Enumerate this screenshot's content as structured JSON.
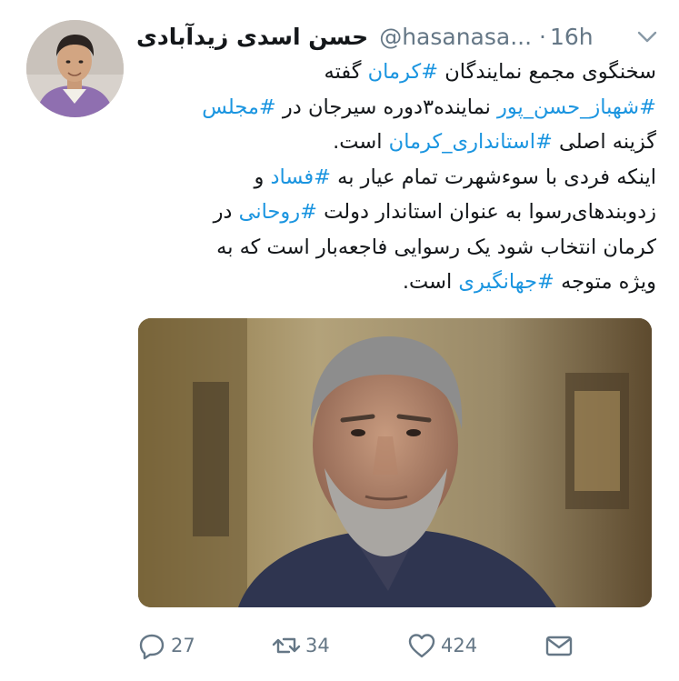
{
  "author": {
    "name": "حسن اسدی زیدآبادی",
    "handle": "@hasanasa...",
    "separator": "·",
    "time": "16h"
  },
  "tweet": {
    "line1": {
      "t1": "سخنگوی مجمع نمایندگان ",
      "h1": "#کرمان",
      "t2": " گفته"
    },
    "line2": {
      "h1": "#شهباز_حسن_پور",
      "t1": " نماینده۳دوره سیرجان در ",
      "h2": "#مجلس"
    },
    "line3": {
      "t1": "گزینه اصلی ",
      "h1": "#استانداری_کرمان",
      "t2": " است."
    },
    "line4": {
      "t1": "اینکه فردی با سوءشهرت تمام عیار به ",
      "h1": "#فساد",
      "t2": " و"
    },
    "line5": {
      "t1": "زدوبندهای‌رسوا به عنوان استاندار دولت ",
      "h1": "#روحانی",
      "t2": " در"
    },
    "line6": {
      "t1": "کرمان انتخاب شود یک رسوایی فاجعه‌بار است که به"
    },
    "line7": {
      "t1": "ویژه متوجه ",
      "h1": "#جهانگیری",
      "t2": " است."
    }
  },
  "actions": {
    "reply_count": "27",
    "retweet_count": "34",
    "like_count": "424"
  },
  "icons": {
    "reply": "reply-icon",
    "retweet": "retweet-icon",
    "like": "heart-icon",
    "dm": "envelope-icon",
    "menu": "chevron-down-icon"
  },
  "colors": {
    "text": "#14171a",
    "secondary": "#657786",
    "hashtag": "#1b95e0"
  }
}
